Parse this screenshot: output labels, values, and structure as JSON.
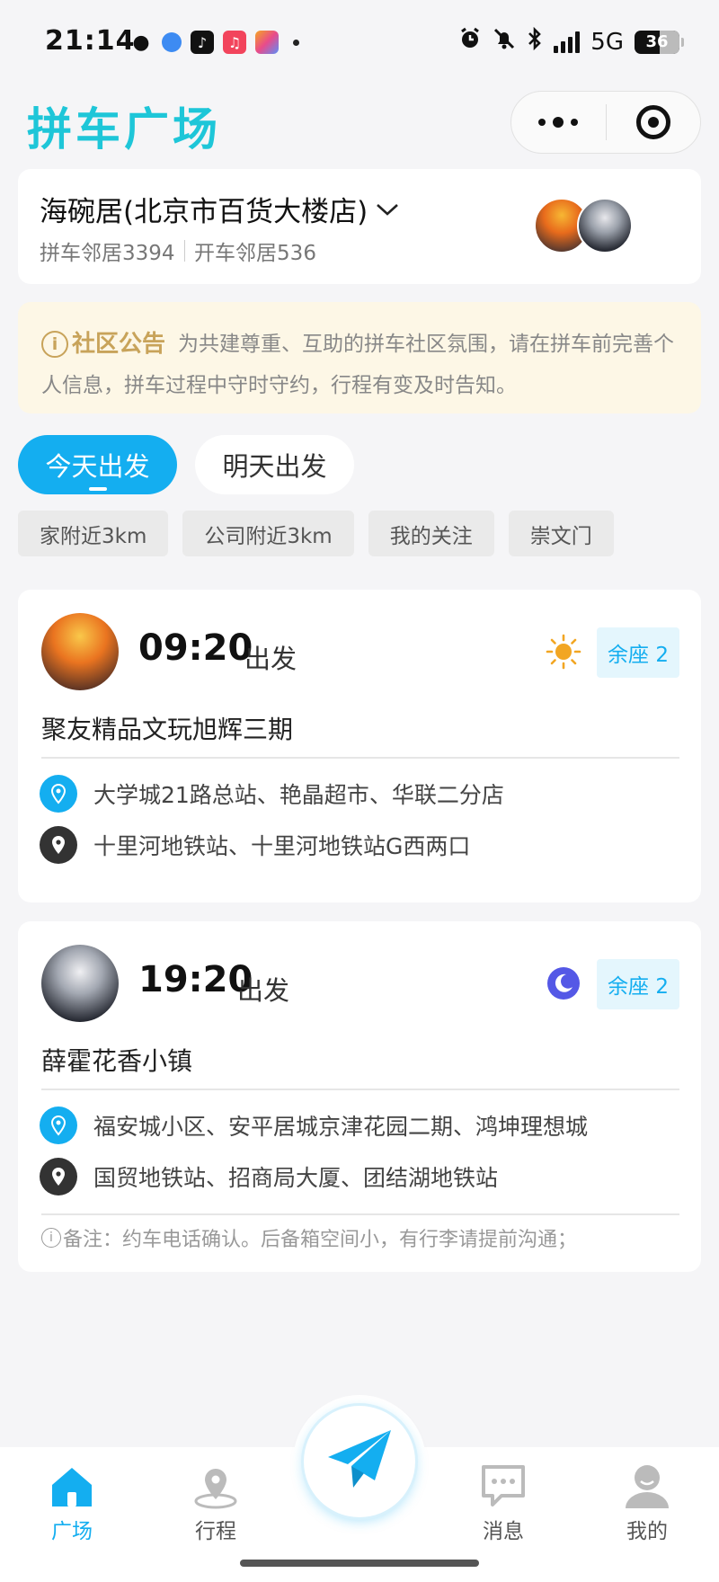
{
  "status_bar": {
    "time": "21:14",
    "network": "5G",
    "battery": "36"
  },
  "header": {
    "title": "拼车广场"
  },
  "community": {
    "name": "海碗居(北京市百货大楼店)",
    "carpool_neighbors": "拼车邻居3394",
    "driver_neighbors": "开车邻居536"
  },
  "notice": {
    "heading": "社区公告",
    "text": "为共建尊重、互助的拼车社区氛围，请在拼车前完善个人信息，拼车过程中守时守约，行程有变及时告知。"
  },
  "day_tabs": [
    {
      "label": "今天出发",
      "active": true
    },
    {
      "label": "明天出发",
      "active": false
    }
  ],
  "filters": [
    "家附近3km",
    "公司附近3km",
    "我的关注",
    "崇文门"
  ],
  "trips": [
    {
      "time": "09:20",
      "depart_label": "出发",
      "weather": "sun-icon",
      "seats": "余座 2",
      "name": "聚友精品文玩旭辉三期",
      "start": "大学城21路总站、艳晶超市、华联二分店",
      "end": "十里河地铁站、十里河地铁站G西两口",
      "remark": ""
    },
    {
      "time": "19:20",
      "depart_label": "出发",
      "weather": "moon-icon",
      "seats": "余座 2",
      "name": "薛霍花香小镇",
      "start": "福安城小区、安平居城京津花园二期、鸿坤理想城",
      "end": "国贸地铁站、招商局大厦、团结湖地铁站",
      "remark": "备注：约车电话确认。后备箱空间小，有行李请提前沟通；"
    }
  ],
  "bottom_nav": {
    "items": [
      {
        "label": "广场",
        "icon": "home-icon",
        "active": true
      },
      {
        "label": "行程",
        "icon": "location-icon",
        "active": false
      },
      {
        "label": "消息",
        "icon": "message-icon",
        "active": false
      },
      {
        "label": "我的",
        "icon": "user-icon",
        "active": false
      }
    ],
    "fab_icon": "send-icon"
  },
  "colors": {
    "accent": "#14aef0",
    "title": "#1ec6d8",
    "notice_bg": "#fdf7e6",
    "notice_head": "#c8a35a"
  }
}
